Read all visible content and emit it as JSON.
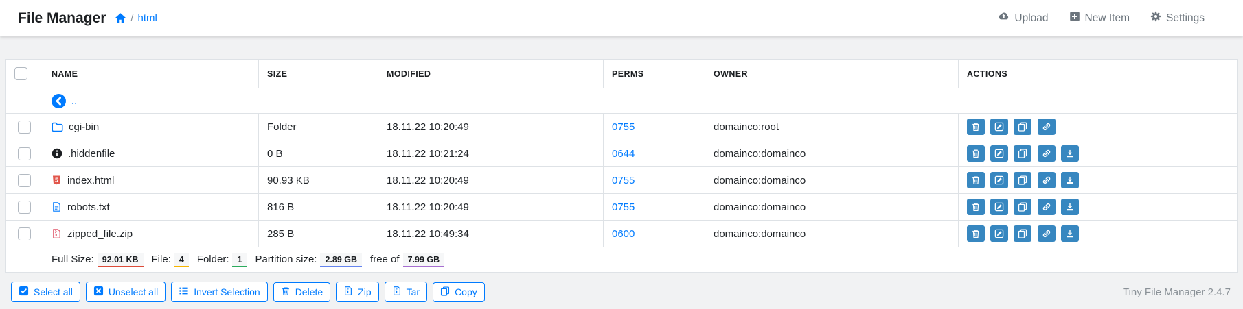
{
  "header": {
    "title": "File Manager",
    "breadcrumb": {
      "home_icon": "home-icon",
      "separator": "/",
      "path": "html"
    },
    "actions": [
      {
        "id": "upload",
        "label": "Upload",
        "icon": "cloud-upload-icon"
      },
      {
        "id": "new-item",
        "label": "New Item",
        "icon": "plus-square-icon"
      },
      {
        "id": "settings",
        "label": "Settings",
        "icon": "gear-icon"
      }
    ]
  },
  "table": {
    "columns": [
      "NAME",
      "SIZE",
      "MODIFIED",
      "PERMS",
      "OWNER",
      "ACTIONS"
    ],
    "up_link": "..",
    "up_icon": "chevron-circle-left-icon",
    "rows": [
      {
        "name": "cgi-bin",
        "icon": "folder-icon",
        "size": "Folder",
        "modified": "18.11.22 10:20:49",
        "perms": "0755",
        "owner": "domainco:root",
        "actions": [
          "delete",
          "edit",
          "copy",
          "link"
        ]
      },
      {
        "name": ".hiddenfile",
        "icon": "info-circle-icon",
        "size": "0 B",
        "modified": "18.11.22 10:21:24",
        "perms": "0644",
        "owner": "domainco:domainco",
        "actions": [
          "delete",
          "edit",
          "copy",
          "link",
          "download"
        ]
      },
      {
        "name": "index.html",
        "icon": "html5-icon",
        "size": "90.93 KB",
        "modified": "18.11.22 10:20:49",
        "perms": "0755",
        "owner": "domainco:domainco",
        "actions": [
          "delete",
          "edit",
          "copy",
          "link",
          "download"
        ]
      },
      {
        "name": "robots.txt",
        "icon": "file-text-icon",
        "size": "816 B",
        "modified": "18.11.22 10:20:49",
        "perms": "0755",
        "owner": "domainco:domainco",
        "actions": [
          "delete",
          "edit",
          "copy",
          "link",
          "download"
        ]
      },
      {
        "name": "zipped_file.zip",
        "icon": "file-archive-icon",
        "size": "285 B",
        "modified": "18.11.22 10:49:34",
        "perms": "0600",
        "owner": "domainco:domainco",
        "actions": [
          "delete",
          "edit",
          "copy",
          "link",
          "download"
        ]
      }
    ],
    "summary": {
      "full_size_label": "Full Size:",
      "full_size": "92.01 KB",
      "file_label": "File:",
      "file_count": "4",
      "folder_label": "Folder:",
      "folder_count": "1",
      "partition_label": "Partition size:",
      "partition_free": "2.89 GB",
      "free_of_label": "free of",
      "partition_total": "7.99 GB"
    }
  },
  "toolbar": {
    "buttons": [
      {
        "id": "select-all",
        "label": "Select all",
        "icon": "check-square-icon"
      },
      {
        "id": "unselect-all",
        "label": "Unselect all",
        "icon": "x-square-icon"
      },
      {
        "id": "invert-selection",
        "label": "Invert Selection",
        "icon": "list-icon"
      },
      {
        "id": "delete",
        "label": "Delete",
        "icon": "trash-icon"
      },
      {
        "id": "zip",
        "label": "Zip",
        "icon": "file-archive-icon"
      },
      {
        "id": "tar",
        "label": "Tar",
        "icon": "file-archive-icon"
      },
      {
        "id": "copy",
        "label": "Copy",
        "icon": "copy-icon"
      }
    ]
  },
  "footer": {
    "version_text": "Tiny File Manager 2.4.7"
  },
  "colors": {
    "accent_blue": "#007bff",
    "action_button_blue": "#3787c0",
    "muted_gray": "#6c757d",
    "border": "#dee2e6",
    "badge_red": "#dd4b39",
    "badge_yellow": "#f7b500",
    "badge_green": "#2bab5d",
    "badge_blue": "#6584ef",
    "badge_purple": "#a76fd1",
    "html5_red": "#e2574c",
    "archive_pink": "#e0566a"
  }
}
